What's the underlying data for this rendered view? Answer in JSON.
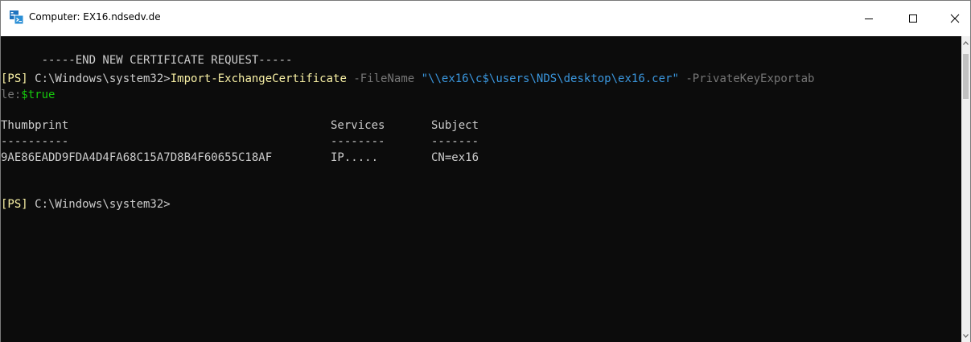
{
  "window": {
    "title": "Computer: EX16.ndsedv.de",
    "icon": "powershell-remote-icon",
    "controls": [
      "minimize-icon",
      "maximize-icon",
      "close-icon"
    ]
  },
  "console": {
    "colors": {
      "background": "#0c0c0c",
      "text": "#cccccc",
      "prompt": "#f9f1a5",
      "parameter": "#767676",
      "string": "#3a96dd",
      "variable": "#16c60c"
    },
    "end_request_line": "-----END NEW CERTIFICATE REQUEST-----",
    "command": {
      "prompt_tag": "[PS]",
      "path": " C:\\Windows\\system32>",
      "cmdlet": "Import-ExchangeCertificate",
      "param_filename": " -FileName ",
      "filename_value": "\"\\\\ex16\\c$\\users\\NDS\\desktop\\ex16.cer\"",
      "param_exportable_part1": " -PrivateKeyExportab",
      "param_exportable_part2": "le:",
      "exportable_value": "$true"
    },
    "table": {
      "headers": [
        "Thumbprint",
        "Services",
        "Subject"
      ],
      "separators": [
        "----------",
        "--------",
        "-------"
      ],
      "rows": [
        [
          "9AE86EADD9FDA4D4FA68C15A7D8B4F60655C18AF",
          "IP.....",
          "CN=ex16"
        ]
      ]
    },
    "final_prompt": {
      "prompt_tag": "[PS]",
      "path": " C:\\Windows\\system32>"
    }
  },
  "scrollbar": {
    "up_icon": "scroll-up-arrow-icon",
    "down_icon": "scroll-down-arrow-icon"
  }
}
